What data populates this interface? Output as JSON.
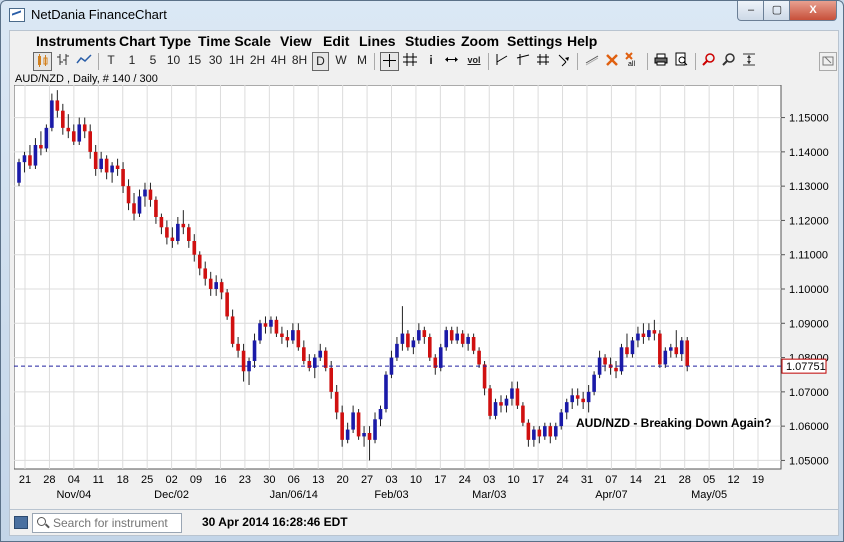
{
  "window": {
    "title": "NetDania FinanceChart",
    "min_label": "–",
    "max_label": "▢",
    "close_label": "X"
  },
  "menu": [
    "Instruments",
    "Chart Type",
    "Time Scale",
    "View",
    "Edit",
    "Lines",
    "Studies",
    "Zoom",
    "Settings",
    "Help"
  ],
  "toolbar": {
    "timescales": [
      "T",
      "1",
      "5",
      "10",
      "15",
      "30",
      "1H",
      "2H",
      "4H",
      "8H",
      "D",
      "W",
      "M"
    ],
    "selected": "D",
    "info_label": "i",
    "vol_label": "vol"
  },
  "chart_header": {
    "symbol_line": "AUD/NZD , Daily, # 140 / 300"
  },
  "status": {
    "search_placeholder": "Search for instrument",
    "datetime": "30 Apr 2014 16:28:46 EDT"
  },
  "colors": {
    "up": "#1a1aa8",
    "down": "#d01010",
    "current_line": "#2020a0",
    "current_label": "#c00000"
  },
  "chart_data": {
    "type": "candlestick",
    "annotation": "AUD/NZD - Breaking Down Again?",
    "current_price": "1.07751",
    "current_value": 1.0775,
    "ylim": [
      1.0475,
      1.1595
    ],
    "y_ticks": [
      1.05,
      1.06,
      1.07,
      1.08,
      1.09,
      1.1,
      1.11,
      1.12,
      1.13,
      1.14,
      1.15
    ],
    "y_tick_labels": [
      "1.05000",
      "1.06000",
      "1.07000",
      "1.08000",
      "1.09000",
      "1.10000",
      "1.11000",
      "1.12000",
      "1.13000",
      "1.14000",
      "1.15000"
    ],
    "x_day_labels": [
      "21",
      "28",
      "04",
      "11",
      "18",
      "25",
      "02",
      "09",
      "16",
      "23",
      "30",
      "06",
      "13",
      "20",
      "27",
      "03",
      "10",
      "17",
      "24",
      "03",
      "10",
      "17",
      "24",
      "31",
      "07",
      "14",
      "21",
      "28",
      "05",
      "12",
      "19"
    ],
    "x_month_labels": [
      {
        "label": "Nov/04",
        "at": "04"
      },
      {
        "label": "Dec/02",
        "at": "02"
      },
      {
        "label": "Jan/06/14",
        "at": "06"
      },
      {
        "label": "Feb/03",
        "at": "03"
      },
      {
        "label": "Mar/03",
        "at": "03"
      },
      {
        "label": "Apr/07",
        "at": "07"
      },
      {
        "label": "May/05",
        "at": "05"
      }
    ],
    "candles": [
      [
        1.131,
        1.138,
        1.13,
        1.137
      ],
      [
        1.137,
        1.14,
        1.134,
        1.139
      ],
      [
        1.139,
        1.142,
        1.135,
        1.136
      ],
      [
        1.136,
        1.144,
        1.135,
        1.142
      ],
      [
        1.142,
        1.146,
        1.139,
        1.141
      ],
      [
        1.141,
        1.148,
        1.14,
        1.147
      ],
      [
        1.147,
        1.157,
        1.146,
        1.155
      ],
      [
        1.155,
        1.158,
        1.15,
        1.152
      ],
      [
        1.152,
        1.154,
        1.145,
        1.147
      ],
      [
        1.147,
        1.151,
        1.144,
        1.146
      ],
      [
        1.146,
        1.148,
        1.142,
        1.143
      ],
      [
        1.143,
        1.15,
        1.142,
        1.148
      ],
      [
        1.148,
        1.15,
        1.144,
        1.146
      ],
      [
        1.146,
        1.148,
        1.138,
        1.14
      ],
      [
        1.14,
        1.142,
        1.133,
        1.135
      ],
      [
        1.135,
        1.14,
        1.134,
        1.138
      ],
      [
        1.138,
        1.139,
        1.132,
        1.134
      ],
      [
        1.134,
        1.137,
        1.131,
        1.136
      ],
      [
        1.136,
        1.138,
        1.133,
        1.135
      ],
      [
        1.135,
        1.137,
        1.128,
        1.13
      ],
      [
        1.13,
        1.132,
        1.123,
        1.125
      ],
      [
        1.125,
        1.128,
        1.12,
        1.122
      ],
      [
        1.122,
        1.129,
        1.121,
        1.127
      ],
      [
        1.127,
        1.131,
        1.124,
        1.129
      ],
      [
        1.129,
        1.131,
        1.124,
        1.126
      ],
      [
        1.126,
        1.127,
        1.119,
        1.121
      ],
      [
        1.121,
        1.122,
        1.116,
        1.118
      ],
      [
        1.118,
        1.12,
        1.113,
        1.115
      ],
      [
        1.115,
        1.118,
        1.112,
        1.114
      ],
      [
        1.114,
        1.121,
        1.113,
        1.119
      ],
      [
        1.119,
        1.123,
        1.116,
        1.118
      ],
      [
        1.118,
        1.119,
        1.112,
        1.114
      ],
      [
        1.114,
        1.116,
        1.108,
        1.11
      ],
      [
        1.11,
        1.111,
        1.104,
        1.106
      ],
      [
        1.106,
        1.108,
        1.101,
        1.103
      ],
      [
        1.103,
        1.105,
        1.098,
        1.1
      ],
      [
        1.1,
        1.104,
        1.098,
        1.102
      ],
      [
        1.102,
        1.103,
        1.097,
        1.099
      ],
      [
        1.099,
        1.1,
        1.091,
        1.092
      ],
      [
        1.092,
        1.094,
        1.083,
        1.084
      ],
      [
        1.084,
        1.086,
        1.08,
        1.082
      ],
      [
        1.082,
        1.084,
        1.073,
        1.076
      ],
      [
        1.076,
        1.08,
        1.072,
        1.079
      ],
      [
        1.079,
        1.087,
        1.077,
        1.085
      ],
      [
        1.085,
        1.091,
        1.084,
        1.09
      ],
      [
        1.09,
        1.092,
        1.087,
        1.089
      ],
      [
        1.089,
        1.092,
        1.087,
        1.091
      ],
      [
        1.091,
        1.092,
        1.086,
        1.087
      ],
      [
        1.087,
        1.089,
        1.084,
        1.086
      ],
      [
        1.086,
        1.088,
        1.083,
        1.085
      ],
      [
        1.085,
        1.09,
        1.084,
        1.088
      ],
      [
        1.088,
        1.09,
        1.082,
        1.083
      ],
      [
        1.083,
        1.085,
        1.078,
        1.079
      ],
      [
        1.079,
        1.081,
        1.076,
        1.077
      ],
      [
        1.077,
        1.081,
        1.074,
        1.08
      ],
      [
        1.08,
        1.084,
        1.079,
        1.082
      ],
      [
        1.082,
        1.083,
        1.076,
        1.077
      ],
      [
        1.077,
        1.079,
        1.068,
        1.07
      ],
      [
        1.07,
        1.072,
        1.062,
        1.064
      ],
      [
        1.064,
        1.066,
        1.054,
        1.056
      ],
      [
        1.056,
        1.061,
        1.055,
        1.059
      ],
      [
        1.059,
        1.066,
        1.058,
        1.064
      ],
      [
        1.064,
        1.065,
        1.056,
        1.057
      ],
      [
        1.057,
        1.06,
        1.054,
        1.058
      ],
      [
        1.058,
        1.06,
        1.05,
        1.056
      ],
      [
        1.056,
        1.064,
        1.055,
        1.062
      ],
      [
        1.062,
        1.066,
        1.06,
        1.065
      ],
      [
        1.065,
        1.076,
        1.064,
        1.075
      ],
      [
        1.075,
        1.082,
        1.074,
        1.08
      ],
      [
        1.08,
        1.086,
        1.079,
        1.084
      ],
      [
        1.084,
        1.095,
        1.082,
        1.087
      ],
      [
        1.087,
        1.088,
        1.082,
        1.083
      ],
      [
        1.083,
        1.086,
        1.081,
        1.085
      ],
      [
        1.085,
        1.09,
        1.084,
        1.088
      ],
      [
        1.088,
        1.089,
        1.084,
        1.086
      ],
      [
        1.086,
        1.087,
        1.079,
        1.08
      ],
      [
        1.08,
        1.081,
        1.075,
        1.077
      ],
      [
        1.077,
        1.084,
        1.076,
        1.083
      ],
      [
        1.083,
        1.089,
        1.082,
        1.088
      ],
      [
        1.088,
        1.089,
        1.084,
        1.085
      ],
      [
        1.085,
        1.089,
        1.084,
        1.087
      ],
      [
        1.087,
        1.088,
        1.083,
        1.084
      ],
      [
        1.084,
        1.087,
        1.082,
        1.086
      ],
      [
        1.086,
        1.087,
        1.081,
        1.082
      ],
      [
        1.082,
        1.083,
        1.077,
        1.078
      ],
      [
        1.078,
        1.079,
        1.069,
        1.071
      ],
      [
        1.071,
        1.072,
        1.062,
        1.063
      ],
      [
        1.063,
        1.068,
        1.062,
        1.067
      ],
      [
        1.067,
        1.069,
        1.064,
        1.066
      ],
      [
        1.066,
        1.069,
        1.064,
        1.068
      ],
      [
        1.068,
        1.073,
        1.066,
        1.071
      ],
      [
        1.071,
        1.073,
        1.065,
        1.066
      ],
      [
        1.066,
        1.067,
        1.06,
        1.061
      ],
      [
        1.061,
        1.062,
        1.054,
        1.056
      ],
      [
        1.056,
        1.06,
        1.054,
        1.059
      ],
      [
        1.059,
        1.06,
        1.055,
        1.057
      ],
      [
        1.057,
        1.061,
        1.056,
        1.06
      ],
      [
        1.06,
        1.061,
        1.055,
        1.057
      ],
      [
        1.057,
        1.061,
        1.056,
        1.06
      ],
      [
        1.06,
        1.065,
        1.059,
        1.064
      ],
      [
        1.064,
        1.068,
        1.062,
        1.067
      ],
      [
        1.067,
        1.071,
        1.065,
        1.069
      ],
      [
        1.069,
        1.071,
        1.066,
        1.068
      ],
      [
        1.068,
        1.07,
        1.065,
        1.067
      ],
      [
        1.067,
        1.072,
        1.064,
        1.07
      ],
      [
        1.07,
        1.076,
        1.069,
        1.075
      ],
      [
        1.075,
        1.082,
        1.074,
        1.08
      ],
      [
        1.08,
        1.081,
        1.076,
        1.078
      ],
      [
        1.078,
        1.08,
        1.075,
        1.077
      ],
      [
        1.077,
        1.079,
        1.074,
        1.076
      ],
      [
        1.076,
        1.084,
        1.075,
        1.083
      ],
      [
        1.083,
        1.087,
        1.08,
        1.081
      ],
      [
        1.081,
        1.086,
        1.08,
        1.085
      ],
      [
        1.085,
        1.089,
        1.083,
        1.087
      ],
      [
        1.087,
        1.09,
        1.084,
        1.086
      ],
      [
        1.086,
        1.09,
        1.085,
        1.088
      ],
      [
        1.088,
        1.091,
        1.085,
        1.087
      ],
      [
        1.087,
        1.088,
        1.077,
        1.078
      ],
      [
        1.078,
        1.083,
        1.077,
        1.082
      ],
      [
        1.082,
        1.084,
        1.08,
        1.083
      ],
      [
        1.083,
        1.088,
        1.08,
        1.081
      ],
      [
        1.081,
        1.086,
        1.079,
        1.085
      ],
      [
        1.085,
        1.086,
        1.076,
        1.0775
      ]
    ]
  }
}
